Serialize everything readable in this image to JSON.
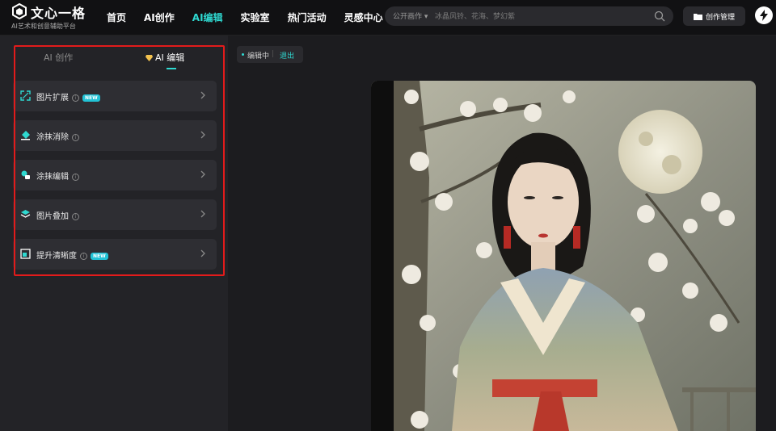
{
  "brand": {
    "title": "文心一格",
    "subtitle": "AI艺术和创意辅助平台"
  },
  "nav": [
    {
      "label": "首页",
      "active": false
    },
    {
      "label": "AI创作",
      "active": false
    },
    {
      "label": "AI编辑",
      "active": true
    },
    {
      "label": "实验室",
      "active": false
    },
    {
      "label": "热门活动",
      "active": false
    },
    {
      "label": "灵感中心",
      "active": false
    }
  ],
  "search": {
    "filter": "公开画作 ▾",
    "placeholder": "冰晶风铃、花海、梦幻紫"
  },
  "header": {
    "create_manage": "创作管理"
  },
  "panel": {
    "tabs": {
      "create": "AI 创作",
      "edit": "AI 编辑"
    },
    "tools": [
      {
        "label": "图片扩展",
        "badge": "NEW",
        "icon": "expand-icon"
      },
      {
        "label": "涂抹消除",
        "badge": "",
        "icon": "eraser-icon"
      },
      {
        "label": "涂抹编辑",
        "badge": "",
        "icon": "brush-edit-icon"
      },
      {
        "label": "图片叠加",
        "badge": "",
        "icon": "layers-icon"
      },
      {
        "label": "提升清晰度",
        "badge": "NEW",
        "icon": "enhance-icon"
      }
    ]
  },
  "editor": {
    "status": "编辑中",
    "exit": "退出"
  },
  "colors": {
    "accent": "#2fd9d1",
    "highlight": "#e21b1b",
    "bg": "#1c1c1f"
  }
}
